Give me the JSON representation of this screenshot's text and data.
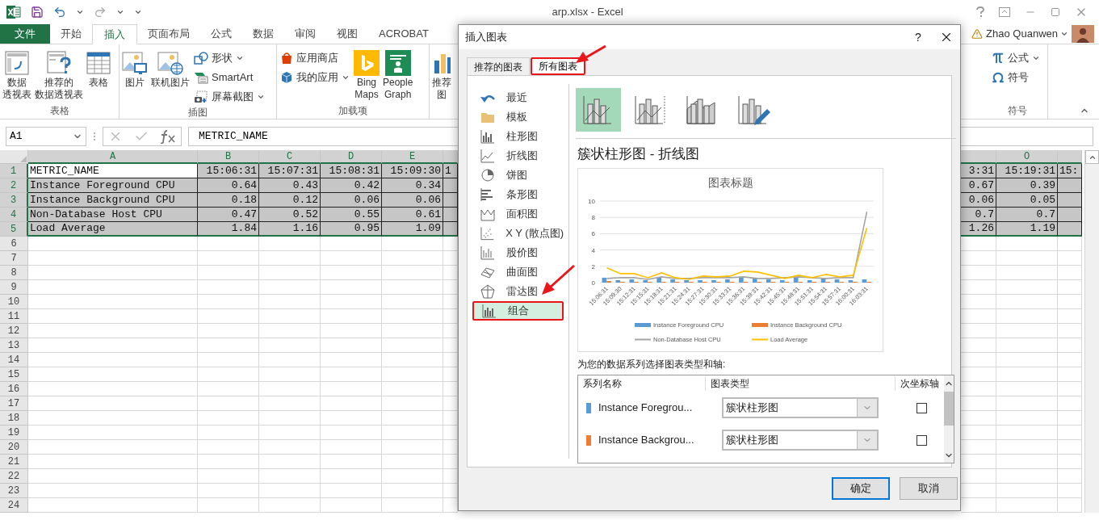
{
  "window": {
    "title": "arp.xlsx - Excel"
  },
  "ribbon_tabs": [
    {
      "label": "文件",
      "kind": "file",
      "selected": false
    },
    {
      "label": "开始",
      "kind": "tab",
      "selected": false
    },
    {
      "label": "插入",
      "kind": "tab",
      "selected": true
    },
    {
      "label": "页面布局",
      "kind": "tab",
      "selected": false
    },
    {
      "label": "公式",
      "kind": "tab",
      "selected": false
    },
    {
      "label": "数据",
      "kind": "tab",
      "selected": false
    },
    {
      "label": "审阅",
      "kind": "tab",
      "selected": false
    },
    {
      "label": "视图",
      "kind": "tab",
      "selected": false
    },
    {
      "label": "ACROBAT",
      "kind": "tab",
      "selected": false
    }
  ],
  "user": {
    "name": "Zhao Quanwen"
  },
  "ribbon_groups": [
    {
      "label": "表格",
      "items": [
        {
          "kind": "large",
          "lines": [
            "数据",
            "透视表"
          ]
        },
        {
          "kind": "large",
          "lines": [
            "推荐的",
            "数据透视表"
          ]
        },
        {
          "kind": "large",
          "lines": [
            "表格"
          ]
        }
      ]
    },
    {
      "label": "插图",
      "items": [
        {
          "kind": "large",
          "lines": [
            "图片"
          ]
        },
        {
          "kind": "large",
          "lines": [
            "联机图片"
          ]
        },
        {
          "kind": "stack",
          "entries": [
            {
              "label": "形状",
              "dropdown": true
            },
            {
              "label": "SmartArt",
              "dropdown": false
            },
            {
              "label": "屏幕截图",
              "dropdown": true
            }
          ]
        }
      ]
    },
    {
      "label": "加载项",
      "items": [
        {
          "kind": "stack",
          "entries": [
            {
              "label": "应用商店",
              "dropdown": false
            },
            {
              "label": "我的应用",
              "dropdown": true
            }
          ]
        },
        {
          "kind": "large",
          "lines": [
            "Bing",
            "Maps"
          ]
        },
        {
          "kind": "large",
          "lines": [
            "People",
            "Graph"
          ]
        }
      ]
    },
    {
      "items": [
        {
          "kind": "large",
          "lines": [
            "推荐",
            "图"
          ]
        }
      ]
    }
  ],
  "ribbon_groups_right": [
    {
      "label": "符号",
      "items": [
        {
          "kind": "stack",
          "entries": [
            {
              "label": "公式",
              "dropdown": true
            },
            {
              "label": "符号",
              "dropdown": false
            }
          ]
        }
      ]
    }
  ],
  "formula_bar": {
    "name_box": "A1",
    "value": "METRIC_NAME"
  },
  "sheet": {
    "columns": [
      {
        "header": "A",
        "selected": true
      },
      {
        "header": "B",
        "selected": true
      },
      {
        "header": "C",
        "selected": true
      },
      {
        "header": "D",
        "selected": true
      },
      {
        "header": "E",
        "selected": true
      },
      {
        "selected": true
      },
      {
        "selected": true
      },
      {
        "header": "O",
        "selected": true
      },
      {
        "selected": true
      }
    ],
    "rows": [
      {
        "number": "1",
        "selected": true,
        "cells": [
          {
            "text": "METRIC_NAME",
            "active": true
          },
          {
            "text": "15:06:31",
            "active": false
          },
          {
            "text": "15:07:31",
            "active": false
          },
          {
            "text": "15:08:31",
            "active": false
          },
          {
            "text": "15:09:30",
            "active": false
          },
          {
            "text": "1",
            "active": false
          },
          {
            "text": "3:31",
            "active": false
          },
          {
            "text": "15:19:31",
            "active": false
          },
          {
            "text": "15:",
            "active": false
          }
        ]
      },
      {
        "number": "2",
        "selected": true,
        "cells": [
          {
            "text": "Instance Foreground CPU",
            "active": false
          },
          {
            "text": "0.64",
            "active": false
          },
          {
            "text": "0.43",
            "active": false
          },
          {
            "text": "0.42",
            "active": false
          },
          {
            "text": "0.34",
            "active": false
          },
          null,
          {
            "text": "0.67",
            "active": false
          },
          {
            "text": "0.39",
            "active": false
          },
          null
        ]
      },
      {
        "number": "3",
        "selected": true,
        "cells": [
          {
            "text": "Instance Background CPU",
            "active": false
          },
          {
            "text": "0.18",
            "active": false
          },
          {
            "text": "0.12",
            "active": false
          },
          {
            "text": "0.06",
            "active": false
          },
          {
            "text": "0.06",
            "active": false
          },
          null,
          {
            "text": "0.06",
            "active": false
          },
          {
            "text": "0.05",
            "active": false
          },
          null
        ]
      },
      {
        "number": "4",
        "selected": true,
        "cells": [
          {
            "text": "Non-Database Host CPU",
            "active": false
          },
          {
            "text": "0.47",
            "active": false
          },
          {
            "text": "0.52",
            "active": false
          },
          {
            "text": "0.55",
            "active": false
          },
          {
            "text": "0.61",
            "active": false
          },
          null,
          {
            "text": "0.7",
            "active": false
          },
          {
            "text": "0.7",
            "active": false
          },
          null
        ]
      },
      {
        "number": "5",
        "selected": true,
        "cells": [
          {
            "text": "Load Average",
            "active": false
          },
          {
            "text": "1.84",
            "active": false
          },
          {
            "text": "1.16",
            "active": false
          },
          {
            "text": "0.95",
            "active": false
          },
          {
            "text": "1.09",
            "active": false
          },
          null,
          {
            "text": "1.26",
            "active": false
          },
          {
            "text": "1.19",
            "active": false
          },
          null
        ]
      },
      {
        "number": "6",
        "selected": false
      },
      {
        "number": "7",
        "selected": false
      },
      {
        "number": "8",
        "selected": false
      },
      {
        "number": "9",
        "selected": false
      },
      {
        "number": "10",
        "selected": false
      },
      {
        "number": "11",
        "selected": false
      },
      {
        "number": "12",
        "selected": false
      },
      {
        "number": "13",
        "selected": false
      },
      {
        "number": "14",
        "selected": false
      },
      {
        "number": "15",
        "selected": false
      },
      {
        "number": "16",
        "selected": false
      },
      {
        "number": "17",
        "selected": false
      },
      {
        "number": "18",
        "selected": false
      },
      {
        "number": "19",
        "selected": false
      },
      {
        "number": "20",
        "selected": false
      },
      {
        "number": "21",
        "selected": false
      },
      {
        "number": "22",
        "selected": false
      },
      {
        "number": "23",
        "selected": false
      },
      {
        "number": "24",
        "selected": false
      }
    ]
  },
  "dialog": {
    "title": "插入图表",
    "help": "?",
    "tabs": [
      {
        "label": "推荐的图表",
        "selected": false,
        "highlighted": false
      },
      {
        "label": "所有图表",
        "selected": true,
        "highlighted": true
      }
    ],
    "chart_types": [
      {
        "label": "最近",
        "selected": false,
        "highlighted": false
      },
      {
        "label": "模板",
        "selected": false,
        "highlighted": false
      },
      {
        "label": "柱形图",
        "selected": false,
        "highlighted": false
      },
      {
        "label": "折线图",
        "selected": false,
        "highlighted": false
      },
      {
        "label": "饼图",
        "selected": false,
        "highlighted": false
      },
      {
        "label": "条形图",
        "selected": false,
        "highlighted": false
      },
      {
        "label": "面积图",
        "selected": false,
        "highlighted": false
      },
      {
        "label": "X Y (散点图)",
        "selected": false,
        "highlighted": false
      },
      {
        "label": "股价图",
        "selected": false,
        "highlighted": false
      },
      {
        "label": "曲面图",
        "selected": false,
        "highlighted": false
      },
      {
        "label": "雷达图",
        "selected": false,
        "highlighted": false
      },
      {
        "label": "组合",
        "selected": true,
        "highlighted": true
      }
    ],
    "subtypes": [
      {
        "selected": true
      },
      {
        "selected": false
      },
      {
        "selected": false
      },
      {
        "selected": false
      }
    ],
    "heading": "簇状柱形图 - 折线图",
    "preview": {
      "chart_data": {
        "type": "bar",
        "title": "图表标题",
        "ylim": [
          0,
          10
        ],
        "yticks": [
          {
            "value": 0,
            "label": "0"
          },
          {
            "value": 2,
            "label": "2"
          },
          {
            "value": 4,
            "label": "4"
          },
          {
            "value": 6,
            "label": "6"
          },
          {
            "value": 8,
            "label": "8"
          },
          {
            "value": 10,
            "label": "10"
          }
        ],
        "grid": true,
        "legend": true,
        "categories": [
          "15:06:31",
          "15:09:30",
          "15:12:31",
          "15:15:31",
          "15:18:31",
          "15:21:31",
          "15:24:31",
          "15:27:31",
          "15:30:31",
          "15:33:31",
          "15:36:31",
          "15:39:31",
          "15:42:31",
          "15:45:31",
          "15:48:31",
          "15:51:31",
          "15:54:31",
          "15:57:31",
          "16:00:31",
          "16:03:31"
        ],
        "series": [
          {
            "name": "Instance Foreground CPU",
            "type": "bar",
            "color": "#5b9bd5",
            "values": [
              0.6,
              0.3,
              0.4,
              0.3,
              0.6,
              0.4,
              0.3,
              0.3,
              0.3,
              0.4,
              0.6,
              0.5,
              0.4,
              0.3,
              0.7,
              0.3,
              0.5,
              0.4,
              0.3,
              0.4
            ]
          },
          {
            "name": "Instance Background CPU",
            "type": "bar",
            "color": "#ed7d31",
            "values": [
              0.2,
              0.1,
              0.1,
              0.1,
              0.1,
              0.1,
              0.1,
              0.1,
              0.1,
              0.1,
              0.1,
              0.1,
              0.1,
              0.1,
              0.1,
              0.1,
              0.1,
              0.1,
              0.1,
              0.1
            ]
          },
          {
            "name": "Non-Database Host CPU",
            "type": "line",
            "color": "#a5a5a5",
            "values": [
              0.5,
              0.6,
              0.6,
              0.4,
              0.7,
              0.5,
              0.5,
              0.6,
              0.6,
              0.6,
              0.7,
              0.5,
              0.5,
              0.6,
              0.7,
              0.6,
              0.5,
              0.6,
              0.6,
              8.7
            ]
          },
          {
            "name": "Load Average",
            "type": "line",
            "color": "#ffc000",
            "values": [
              1.8,
              1.1,
              1.1,
              0.6,
              1.2,
              0.6,
              0.4,
              0.8,
              0.7,
              0.8,
              1.4,
              1.3,
              0.9,
              0.5,
              0.9,
              0.6,
              1.0,
              0.7,
              0.9,
              6.7
            ]
          }
        ]
      }
    },
    "series_prompt": "为您的数据系列选择图表类型和轴:",
    "series_table": {
      "columns": [
        "系列名称",
        "图表类型",
        "次坐标轴"
      ],
      "rows": [
        {
          "name": "Instance Foregrou...",
          "color": "#5b9bd5",
          "chart_type": "簇状柱形图",
          "secondary_axis": false
        },
        {
          "name": "Instance Backgrou...",
          "color": "#ed7d31",
          "chart_type": "簇状柱形图",
          "secondary_axis": false
        }
      ]
    },
    "buttons": [
      {
        "label": "确定",
        "default": true
      },
      {
        "label": "取消",
        "default": false
      }
    ]
  }
}
